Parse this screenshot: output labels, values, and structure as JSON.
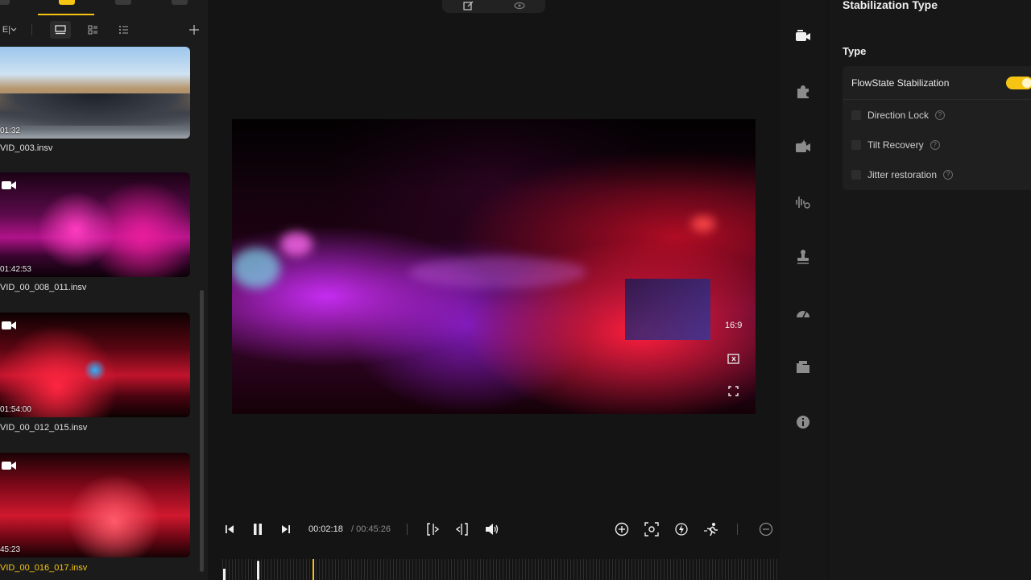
{
  "left_panel": {
    "tabs": [
      "media-tab",
      "project-tab",
      "cloud-tab",
      "other-tab"
    ],
    "toolbar": {
      "filter_label": "E|",
      "view_modes": [
        "single-view-icon",
        "grid-view-icon",
        "list-view-icon"
      ],
      "add_icon": "plus-icon"
    },
    "media": [
      {
        "duration": "01:32",
        "name": "VID_003.insv",
        "selected": false
      },
      {
        "duration": "01:42:53",
        "name": "VID_00_008_011.insv",
        "selected": false
      },
      {
        "duration": "01:54:00",
        "name": "VID_00_012_015.insv",
        "selected": false
      },
      {
        "duration": "45:23",
        "name": "VID_00_016_017.insv",
        "selected": true
      }
    ]
  },
  "preview": {
    "aspect_ratio": "16:9",
    "top_toolbar": [
      "edit-icon",
      "eye-icon"
    ]
  },
  "transport": {
    "current_time": "00:02:18",
    "total_time": "/ 00:45:26"
  },
  "rail": {
    "items": [
      "camera-icon",
      "plugin-icon",
      "media-effects-icon",
      "audio-icon",
      "stamp-icon",
      "speed-icon",
      "export-icon",
      "info-icon"
    ]
  },
  "properties": {
    "title": "Stabilization Type",
    "section": "Type",
    "main_option": "FlowState Stabilization",
    "main_option_enabled": true,
    "options": [
      {
        "label": "Direction Lock",
        "checked": false
      },
      {
        "label": "Tilt Recovery",
        "checked": false
      },
      {
        "label": "Jitter restoration",
        "checked": false
      }
    ]
  },
  "colors": {
    "accent": "#f6c514",
    "background": "#141414",
    "panel": "#1b1b1b"
  }
}
